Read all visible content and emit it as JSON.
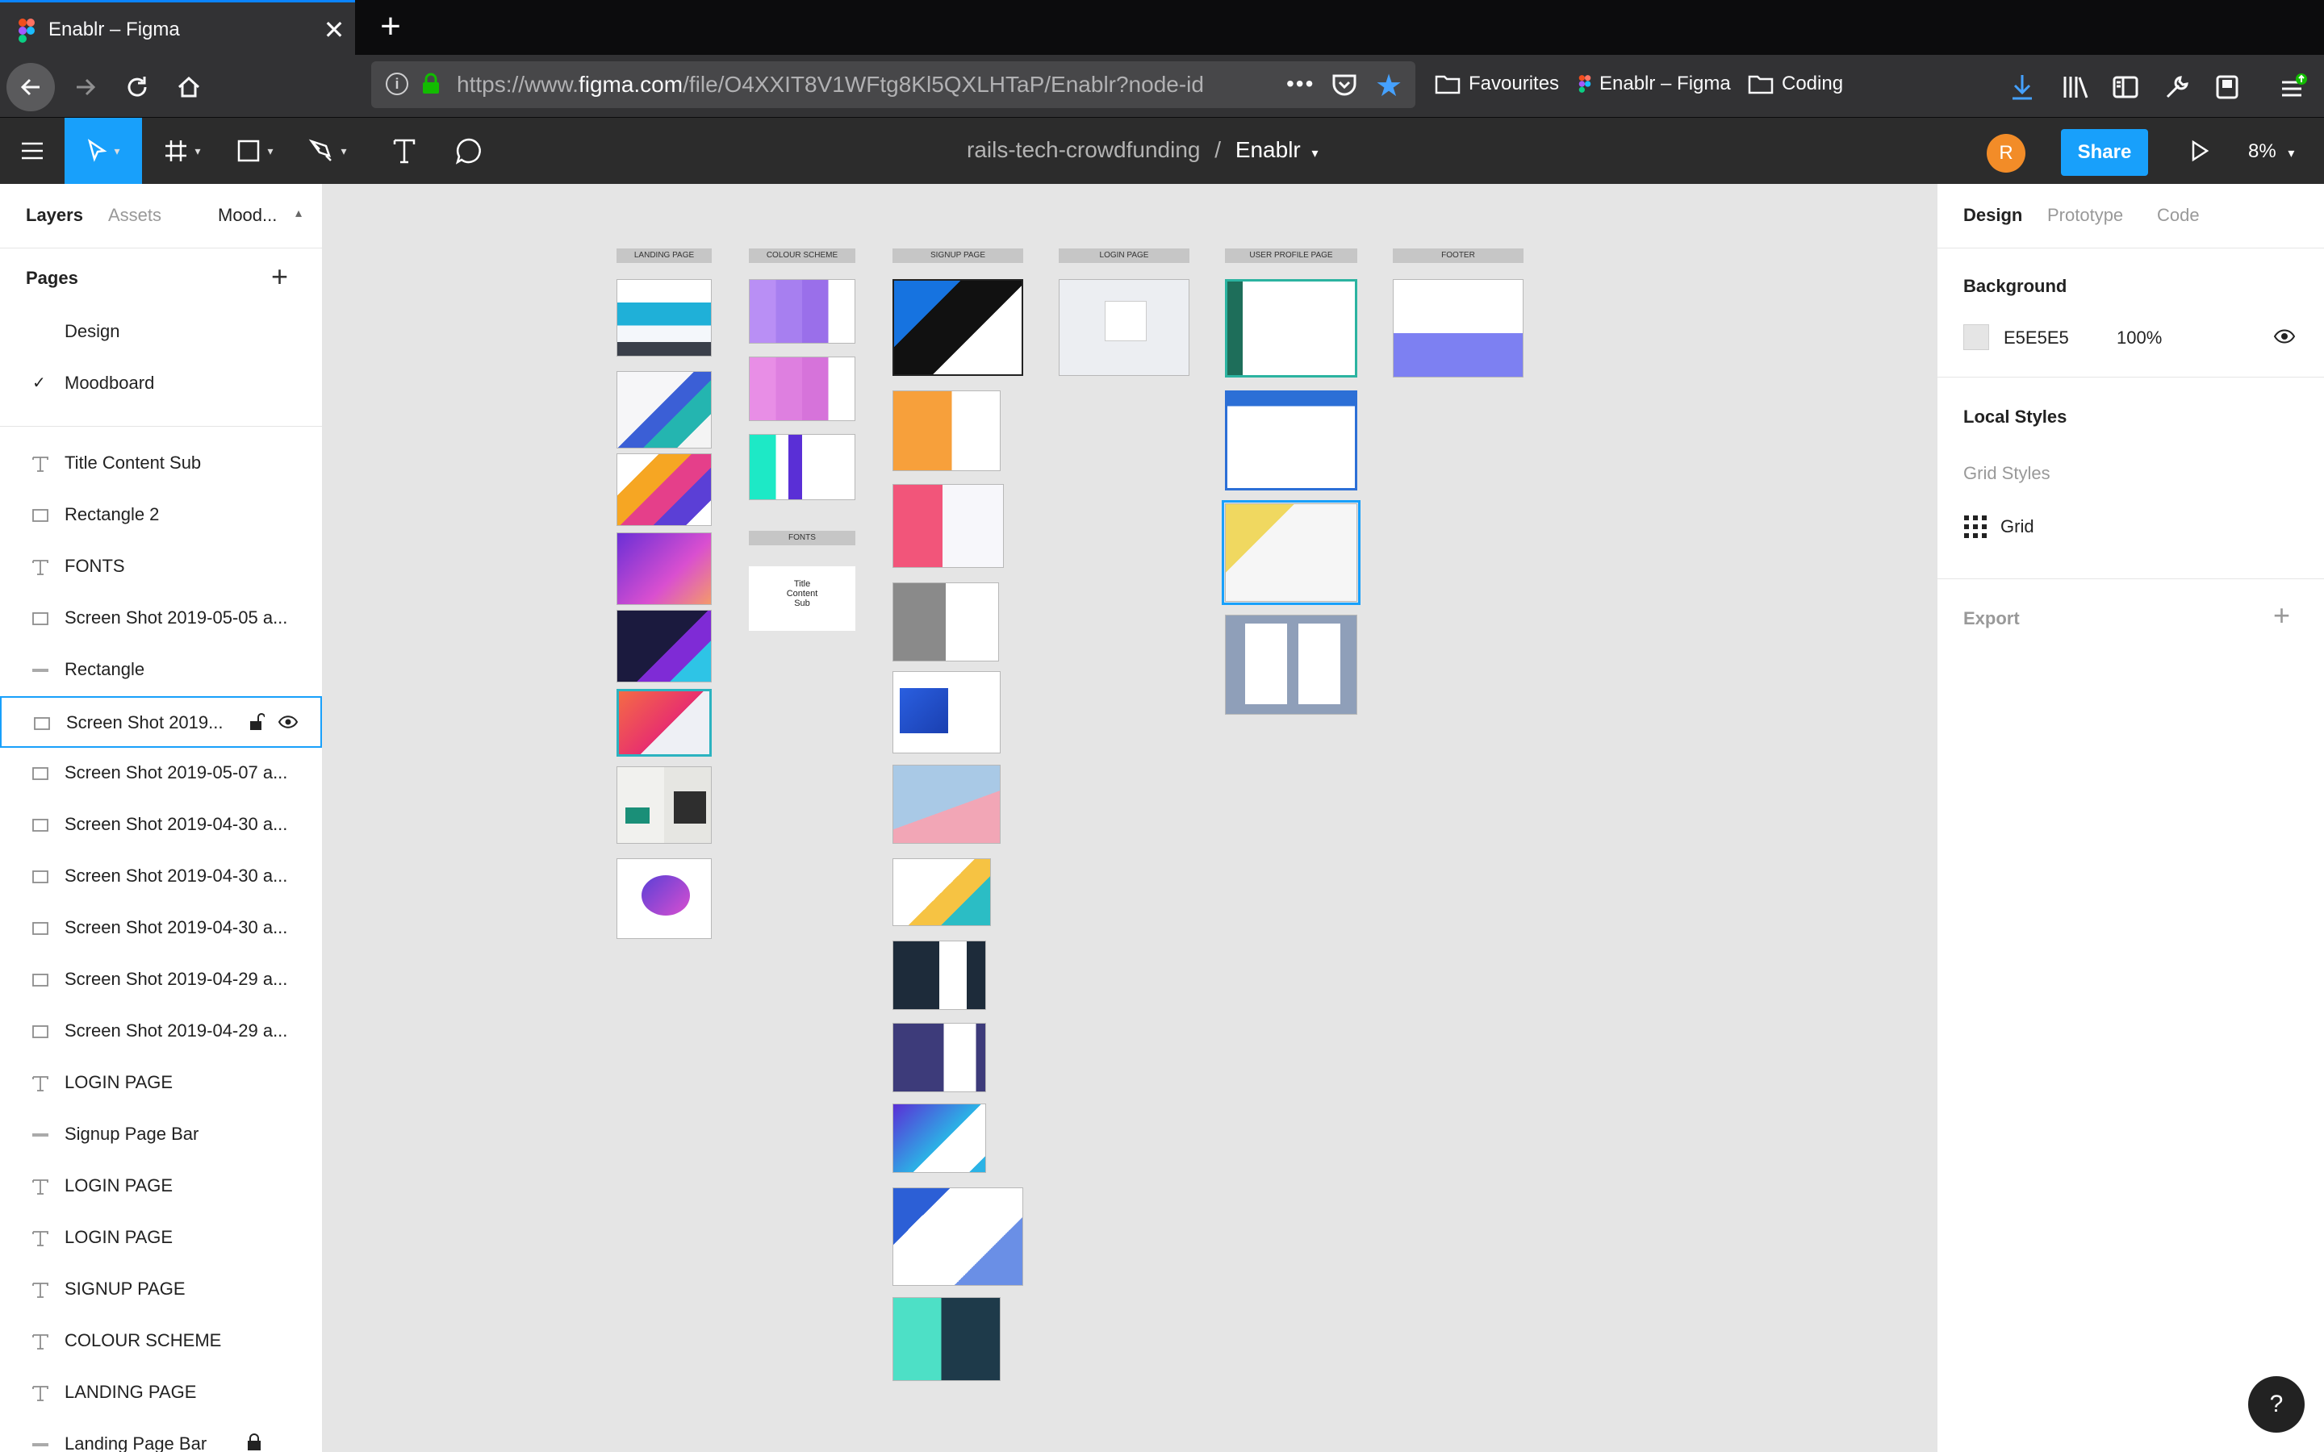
{
  "browser": {
    "tab_title": "Enablr – Figma",
    "url_prefix": "https://www.",
    "url_host": "figma.com",
    "url_path": "/file/O4XXIT8V1WFtg8Kl5QXLHTaP/Enablr?node-id",
    "bookmarks": [
      "Favourites",
      "Enablr – Figma",
      "Coding"
    ]
  },
  "toolbar": {
    "project": "rails-tech-crowdfunding",
    "separator": "/",
    "file": "Enablr",
    "avatar_initial": "R",
    "share_label": "Share",
    "zoom": "8%"
  },
  "left_panel": {
    "tabs": [
      "Layers",
      "Assets",
      "Mood..."
    ],
    "pages_label": "Pages",
    "pages": [
      {
        "label": "Design",
        "current": false
      },
      {
        "label": "Moodboard",
        "current": true
      }
    ],
    "layers": [
      {
        "label": "Title Content Sub",
        "type": "text"
      },
      {
        "label": "Rectangle 2",
        "type": "rect"
      },
      {
        "label": "FONTS",
        "type": "text"
      },
      {
        "label": "Screen Shot 2019-05-05 a...",
        "type": "rect"
      },
      {
        "label": "Rectangle",
        "type": "line"
      },
      {
        "label": "Screen Shot 2019...",
        "type": "rect",
        "selected": true
      },
      {
        "label": "Screen Shot 2019-05-07 a...",
        "type": "rect"
      },
      {
        "label": "Screen Shot 2019-04-30 a...",
        "type": "rect"
      },
      {
        "label": "Screen Shot 2019-04-30 a...",
        "type": "rect"
      },
      {
        "label": "Screen Shot 2019-04-30 a...",
        "type": "rect"
      },
      {
        "label": "Screen Shot 2019-04-29 a...",
        "type": "rect"
      },
      {
        "label": "Screen Shot 2019-04-29 a...",
        "type": "rect"
      },
      {
        "label": "LOGIN PAGE",
        "type": "text"
      },
      {
        "label": "Signup Page Bar",
        "type": "line"
      },
      {
        "label": "LOGIN PAGE",
        "type": "text"
      },
      {
        "label": "LOGIN PAGE",
        "type": "text"
      },
      {
        "label": "SIGNUP PAGE",
        "type": "text"
      },
      {
        "label": "COLOUR SCHEME",
        "type": "text"
      },
      {
        "label": "LANDING PAGE",
        "type": "text"
      },
      {
        "label": "Landing Page Bar",
        "type": "line",
        "locked": true
      }
    ]
  },
  "canvas": {
    "frame_labels": [
      "LANDING PAGE",
      "COLOUR SCHEME",
      "SIGNUP PAGE",
      "LOGIN PAGE",
      "USER PROFILE PAGE",
      "FOOTER",
      "FONTS"
    ],
    "fonts_sample": [
      "Title",
      "Content",
      "Sub"
    ]
  },
  "right_panel": {
    "tabs": [
      "Design",
      "Prototype",
      "Code"
    ],
    "background_label": "Background",
    "background_hex": "E5E5E5",
    "background_opacity": "100%",
    "local_styles_label": "Local Styles",
    "grid_styles_label": "Grid Styles",
    "grid_label": "Grid",
    "export_label": "Export"
  },
  "help_label": "?",
  "colors": {
    "accent": "#18a0fb",
    "canvas": "#e5e5e5",
    "toolbar": "#2c2c2c",
    "avatar": "#f28c28"
  }
}
